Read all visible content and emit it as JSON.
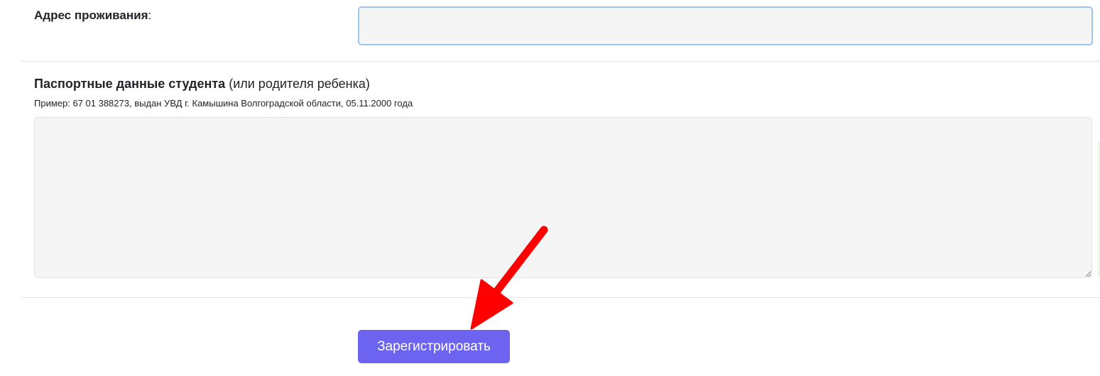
{
  "address": {
    "label_bold": "Адрес проживания",
    "label_suffix": ":",
    "value": ""
  },
  "passport": {
    "label_bold": "Паспортные данные студента",
    "label_rest": " (или родителя ребенка)",
    "hint": "Пример: 67 01 388273, выдан УВД г. Камышина Волгоградской области, 05.11.2000 года",
    "value": ""
  },
  "submit": {
    "label": "Зарегистрировать"
  },
  "annotation": {
    "arrow_color": "#ff0000",
    "arrow_icon": "red-arrow-icon"
  },
  "colors": {
    "button_bg": "#6c63f0",
    "input_bg": "#f5f5f5",
    "focus_border": "#9ec5ee"
  }
}
